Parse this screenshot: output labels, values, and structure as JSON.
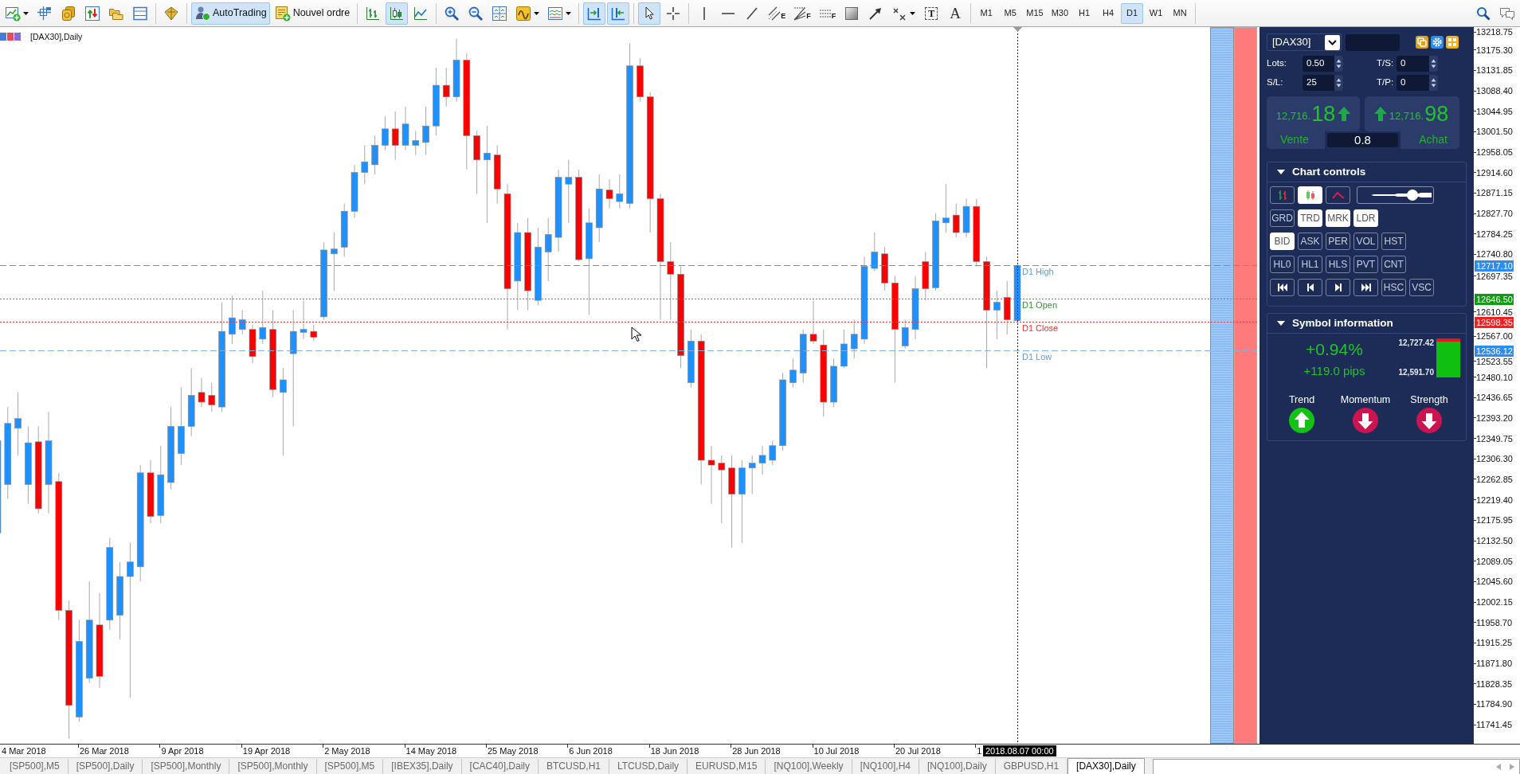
{
  "toolbar": {
    "groups": [
      [
        {
          "kind": "new-chart",
          "pressed": false,
          "dropdown": true
        },
        {
          "kind": "profiles",
          "pressed": false
        },
        {
          "kind": "market-watch",
          "pressed": false
        },
        {
          "kind": "data-window",
          "pressed": false
        },
        {
          "kind": "navigator",
          "pressed": false
        },
        {
          "kind": "terminal",
          "pressed": false
        }
      ],
      [
        {
          "kind": "tester",
          "pressed": false
        }
      ],
      [
        {
          "kind": "autotrading",
          "label": "AutoTrading",
          "pressed": true
        },
        {
          "kind": "new-order",
          "label": "Nouvel ordre",
          "pressed": false
        }
      ],
      [
        {
          "kind": "bar-chart",
          "pressed": false
        },
        {
          "kind": "candle-chart",
          "pressed": true
        },
        {
          "kind": "line-chart",
          "pressed": false
        }
      ],
      [
        {
          "kind": "zoom-in",
          "pressed": false
        },
        {
          "kind": "zoom-out",
          "pressed": false
        },
        {
          "kind": "tile",
          "pressed": false
        },
        {
          "kind": "indicators",
          "pressed": false,
          "dropdown": true
        },
        {
          "kind": "templates",
          "pressed": false,
          "dropdown": true
        }
      ],
      [
        {
          "kind": "auto-scroll",
          "pressed": true
        },
        {
          "kind": "chart-shift",
          "pressed": true
        }
      ],
      [
        {
          "kind": "cursor",
          "pressed": true
        },
        {
          "kind": "crosshair",
          "pressed": false
        }
      ],
      [
        {
          "kind": "vertical-line",
          "pressed": false
        },
        {
          "kind": "horizontal-line",
          "pressed": false
        },
        {
          "kind": "trendline",
          "pressed": false
        },
        {
          "kind": "channel",
          "glyph": "E",
          "pressed": false
        },
        {
          "kind": "fibo",
          "glyph": "F",
          "pressed": false
        },
        {
          "kind": "fibo-lines",
          "glyph": "F",
          "pressed": false
        },
        {
          "kind": "rectangle",
          "pressed": false
        },
        {
          "kind": "arrow",
          "pressed": false
        },
        {
          "kind": "percent",
          "pressed": false,
          "dropdown": true
        },
        {
          "kind": "text-label",
          "glyph": "T",
          "pressed": false
        },
        {
          "kind": "text",
          "glyph": "A",
          "pressed": false
        }
      ]
    ],
    "timeframes": [
      {
        "label": "M1",
        "selected": false
      },
      {
        "label": "M5",
        "selected": false
      },
      {
        "label": "M15",
        "selected": false
      },
      {
        "label": "M30",
        "selected": false
      },
      {
        "label": "H1",
        "selected": false
      },
      {
        "label": "H4",
        "selected": false
      },
      {
        "label": "D1",
        "selected": true
      },
      {
        "label": "W1",
        "selected": false
      },
      {
        "label": "MN",
        "selected": false
      }
    ],
    "tools": [
      {
        "kind": "search"
      },
      {
        "kind": "chat"
      }
    ]
  },
  "chart": {
    "title": "[DAX30],Daily",
    "price_lines": [
      {
        "kind": "high",
        "label": "D1 High",
        "price_tag": "12717.10"
      },
      {
        "kind": "open",
        "label": "D1 Open",
        "price_tag": "12646.50"
      },
      {
        "kind": "close",
        "label": "D1 Close",
        "price_tag": "12598.35"
      },
      {
        "kind": "low",
        "label": "D1 Low",
        "price_tag": "12536.12"
      }
    ]
  },
  "panel": {
    "symbol": "[DAX30]",
    "order_fields": [
      {
        "label": "Lots:",
        "value": "0.50"
      },
      {
        "label": "T/S:",
        "value": "0"
      },
      {
        "label": "S/L:",
        "value": "25"
      },
      {
        "label": "T/P:",
        "value": "0"
      }
    ],
    "quotes": [
      {
        "kind": "sell",
        "price_head": "12,716.",
        "price_tail": "18",
        "rising": true,
        "label": "Vente"
      },
      {
        "kind": "buy",
        "price_head": "12,716.",
        "price_tail": "98",
        "rising": true,
        "label": "Achat"
      }
    ],
    "spread": "0.8",
    "sections": [
      {
        "kind": "chart-controls",
        "title": "Chart controls",
        "expanded": true,
        "rows": [
          [
            {
              "kind": "bar-chart",
              "selected": false
            },
            {
              "kind": "candles",
              "selected": true
            },
            {
              "kind": "line",
              "selected": false
            },
            {
              "kind": "slider",
              "level": 0.73
            }
          ],
          [
            {
              "kind": "toggle",
              "label": "GRD",
              "selected": false
            },
            {
              "kind": "toggle",
              "label": "TRD",
              "selected": true
            },
            {
              "kind": "toggle",
              "label": "MRK",
              "selected": true
            },
            {
              "kind": "toggle",
              "label": "LDR",
              "selected": true
            }
          ],
          [
            {
              "kind": "toggle",
              "label": "BID",
              "selected": true
            },
            {
              "kind": "toggle",
              "label": "ASK",
              "selected": false
            },
            {
              "kind": "toggle",
              "label": "PER",
              "selected": false
            },
            {
              "kind": "toggle",
              "label": "VOL",
              "selected": false
            },
            {
              "kind": "toggle",
              "label": "HST",
              "selected": false
            }
          ],
          [
            {
              "kind": "toggle",
              "label": "HL0",
              "selected": false
            },
            {
              "kind": "toggle",
              "label": "HL1",
              "selected": false
            },
            {
              "kind": "toggle",
              "label": "HLS",
              "selected": false
            },
            {
              "kind": "toggle",
              "label": "PVT",
              "selected": false
            },
            {
              "kind": "toggle",
              "label": "CNT",
              "selected": false
            }
          ],
          [
            {
              "kind": "first",
              "selected": false
            },
            {
              "kind": "previous",
              "selected": false
            },
            {
              "kind": "next",
              "selected": false
            },
            {
              "kind": "last",
              "selected": false
            },
            {
              "kind": "toggle",
              "label": "HSC",
              "selected": false
            },
            {
              "kind": "toggle",
              "label": "VSC",
              "selected": false
            }
          ]
        ]
      },
      {
        "kind": "symbol-info",
        "title": "Symbol information",
        "expanded": true,
        "change": "+0.94%",
        "pips": "+119.0 pips",
        "range_high": "12,727.42",
        "range_low": "12,591.70",
        "range_bar": {
          "level": 0.92
        },
        "signals": [
          {
            "label": "Trend",
            "rising": true
          },
          {
            "label": "Momentum",
            "rising": false
          },
          {
            "label": "Strength",
            "rising": false
          }
        ]
      }
    ]
  },
  "price_axis": {
    "ticks": [
      "13218.75",
      "13175.30",
      "13131.85",
      "13088.40",
      "13044.95",
      "13001.50",
      "12958.05",
      "12914.60",
      "12871.15",
      "12827.70",
      "12784.25",
      "12740.80",
      "12697.35",
      "12610.45",
      "12567.00",
      "12523.55",
      "12480.10",
      "12436.65",
      "12393.20",
      "12349.75",
      "12306.30",
      "12262.85",
      "12219.40",
      "12175.95",
      "12132.50",
      "12089.05",
      "12045.60",
      "12002.15",
      "11958.70",
      "11915.25",
      "11871.80",
      "11828.35",
      "11784.90",
      "11741.45"
    ]
  },
  "time_axis": {
    "labels": [
      "4 Mar 2018",
      "26 Mar 2018",
      "9 Apr 2018",
      "19 Apr 2018",
      "2 May 2018",
      "14 May 2018",
      "25 May 2018",
      "6 Jun 2018",
      "18 Jun 2018",
      "28 Jun 2018",
      "10 Jul 2018",
      "20 Jul 2018",
      "1"
    ],
    "cursor_label": "2018.08.07 00:00"
  },
  "tabs": [
    {
      "label": "[SP500],M5",
      "selected": false
    },
    {
      "label": "[SP500],Daily",
      "selected": false
    },
    {
      "label": "[SP500],Monthly",
      "selected": false
    },
    {
      "label": "[SP500],Monthly",
      "selected": false
    },
    {
      "label": "[SP500],M5",
      "selected": false
    },
    {
      "label": "[IBEX35],Daily",
      "selected": false
    },
    {
      "label": "[CAC40],Daily",
      "selected": false
    },
    {
      "label": "BTCUSD,H1",
      "selected": false
    },
    {
      "label": "LTCUSD,Daily",
      "selected": false
    },
    {
      "label": "EURUSD,M15",
      "selected": false
    },
    {
      "label": "[NQ100],Weekly",
      "selected": false
    },
    {
      "label": "[NQ100],H4",
      "selected": false
    },
    {
      "label": "[NQ100],Daily",
      "selected": false
    },
    {
      "label": "GBPUSD,H1",
      "selected": false
    },
    {
      "label": "[DAX30],Daily",
      "selected": true
    }
  ]
}
